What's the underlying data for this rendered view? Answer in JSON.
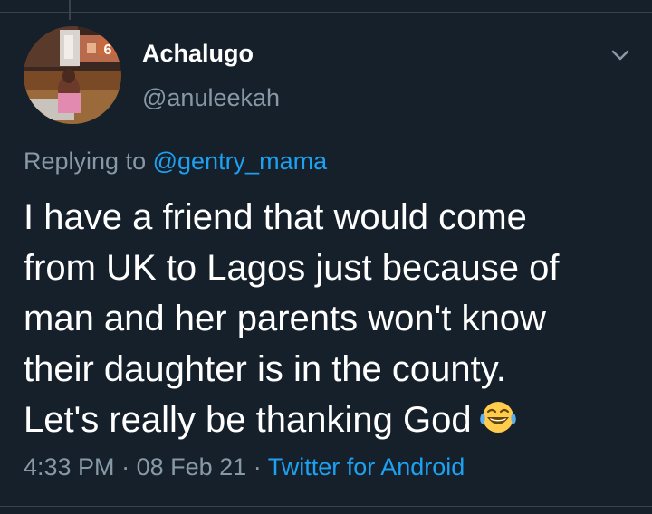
{
  "tweet": {
    "author_name": "Achalugo",
    "author_handle": "@anuleekah",
    "replying_prefix": "Replying to",
    "replying_to": "@gentry_mama",
    "text_lines": [
      "I have a friend that would come",
      "from UK to Lagos just because of",
      "man and her parents won't know",
      "their daughter is in the county.",
      "Let's really be thanking God"
    ],
    "emoji": "face-with-tears-of-joy",
    "time": "4:33 PM",
    "separator": "·",
    "date": "08 Feb 21",
    "source": "Twitter for Android"
  },
  "avatar_sign_text": "6",
  "colors": {
    "background": "#15202b",
    "text": "#ffffff",
    "secondary": "#8899a6",
    "link": "#1da1f2",
    "divider": "#38444d"
  }
}
